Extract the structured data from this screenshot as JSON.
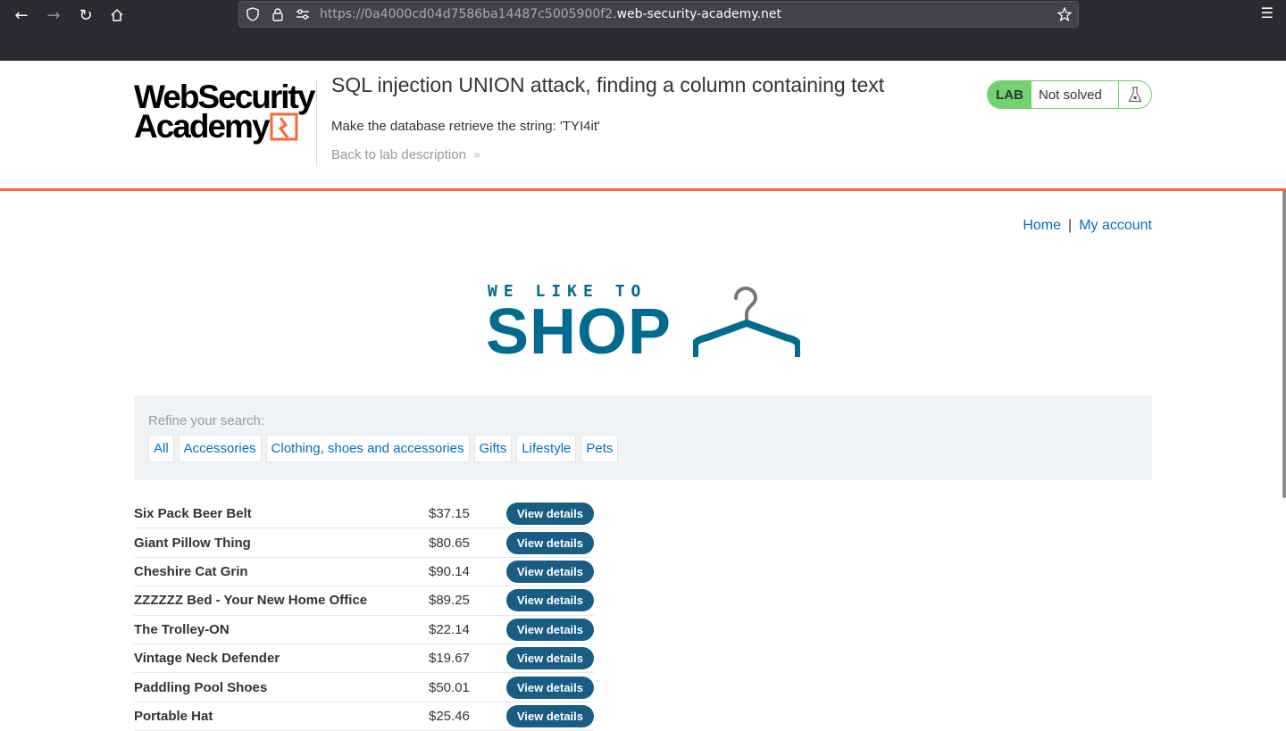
{
  "browser": {
    "url_prefix": "https://0a4000cd04d7586ba14487c5005900f2.",
    "url_host": "web-security-academy.net",
    "icons": {
      "back": "back-arrow-icon",
      "forward": "forward-arrow-icon",
      "reload": "reload-icon",
      "home": "home-icon",
      "shield": "shield-icon",
      "lock": "lock-icon",
      "permissions": "permissions-icon",
      "bookmark": "star-icon",
      "menu": "hamburger-menu-icon"
    }
  },
  "academy_header": {
    "logo_line1": "WebSecurity",
    "logo_line2": "Academy",
    "title": "SQL injection UNION attack, finding a column containing text",
    "goal": "Make the database retrieve the string: 'TYI4it'",
    "back_link": "Back to lab description",
    "status": {
      "tag": "LAB",
      "text": "Not solved",
      "icon": "flask-icon",
      "accent": "#70d16d"
    },
    "accent_color": "#ff6633"
  },
  "top_nav": {
    "home": "Home",
    "separator": "|",
    "account": "My account"
  },
  "banner": {
    "small_text": "WE LIKE TO",
    "big_text": "SHOP",
    "icon": "coat-hanger-icon",
    "color": "#006b8f"
  },
  "filter": {
    "label": "Refine your search:",
    "categories": [
      "All",
      "Accessories",
      "Clothing, shoes and accessories",
      "Gifts",
      "Lifestyle",
      "Pets"
    ]
  },
  "products": [
    {
      "name": "Six Pack Beer Belt",
      "price": "$37.15",
      "action": "View details"
    },
    {
      "name": "Giant Pillow Thing",
      "price": "$80.65",
      "action": "View details"
    },
    {
      "name": "Cheshire Cat Grin",
      "price": "$90.14",
      "action": "View details"
    },
    {
      "name": "ZZZZZZ Bed - Your New Home Office",
      "price": "$89.25",
      "action": "View details"
    },
    {
      "name": "The Trolley-ON",
      "price": "$22.14",
      "action": "View details"
    },
    {
      "name": "Vintage Neck Defender",
      "price": "$19.67",
      "action": "View details"
    },
    {
      "name": "Paddling Pool Shoes",
      "price": "$50.01",
      "action": "View details"
    },
    {
      "name": "Portable Hat",
      "price": "$25.46",
      "action": "View details"
    }
  ]
}
